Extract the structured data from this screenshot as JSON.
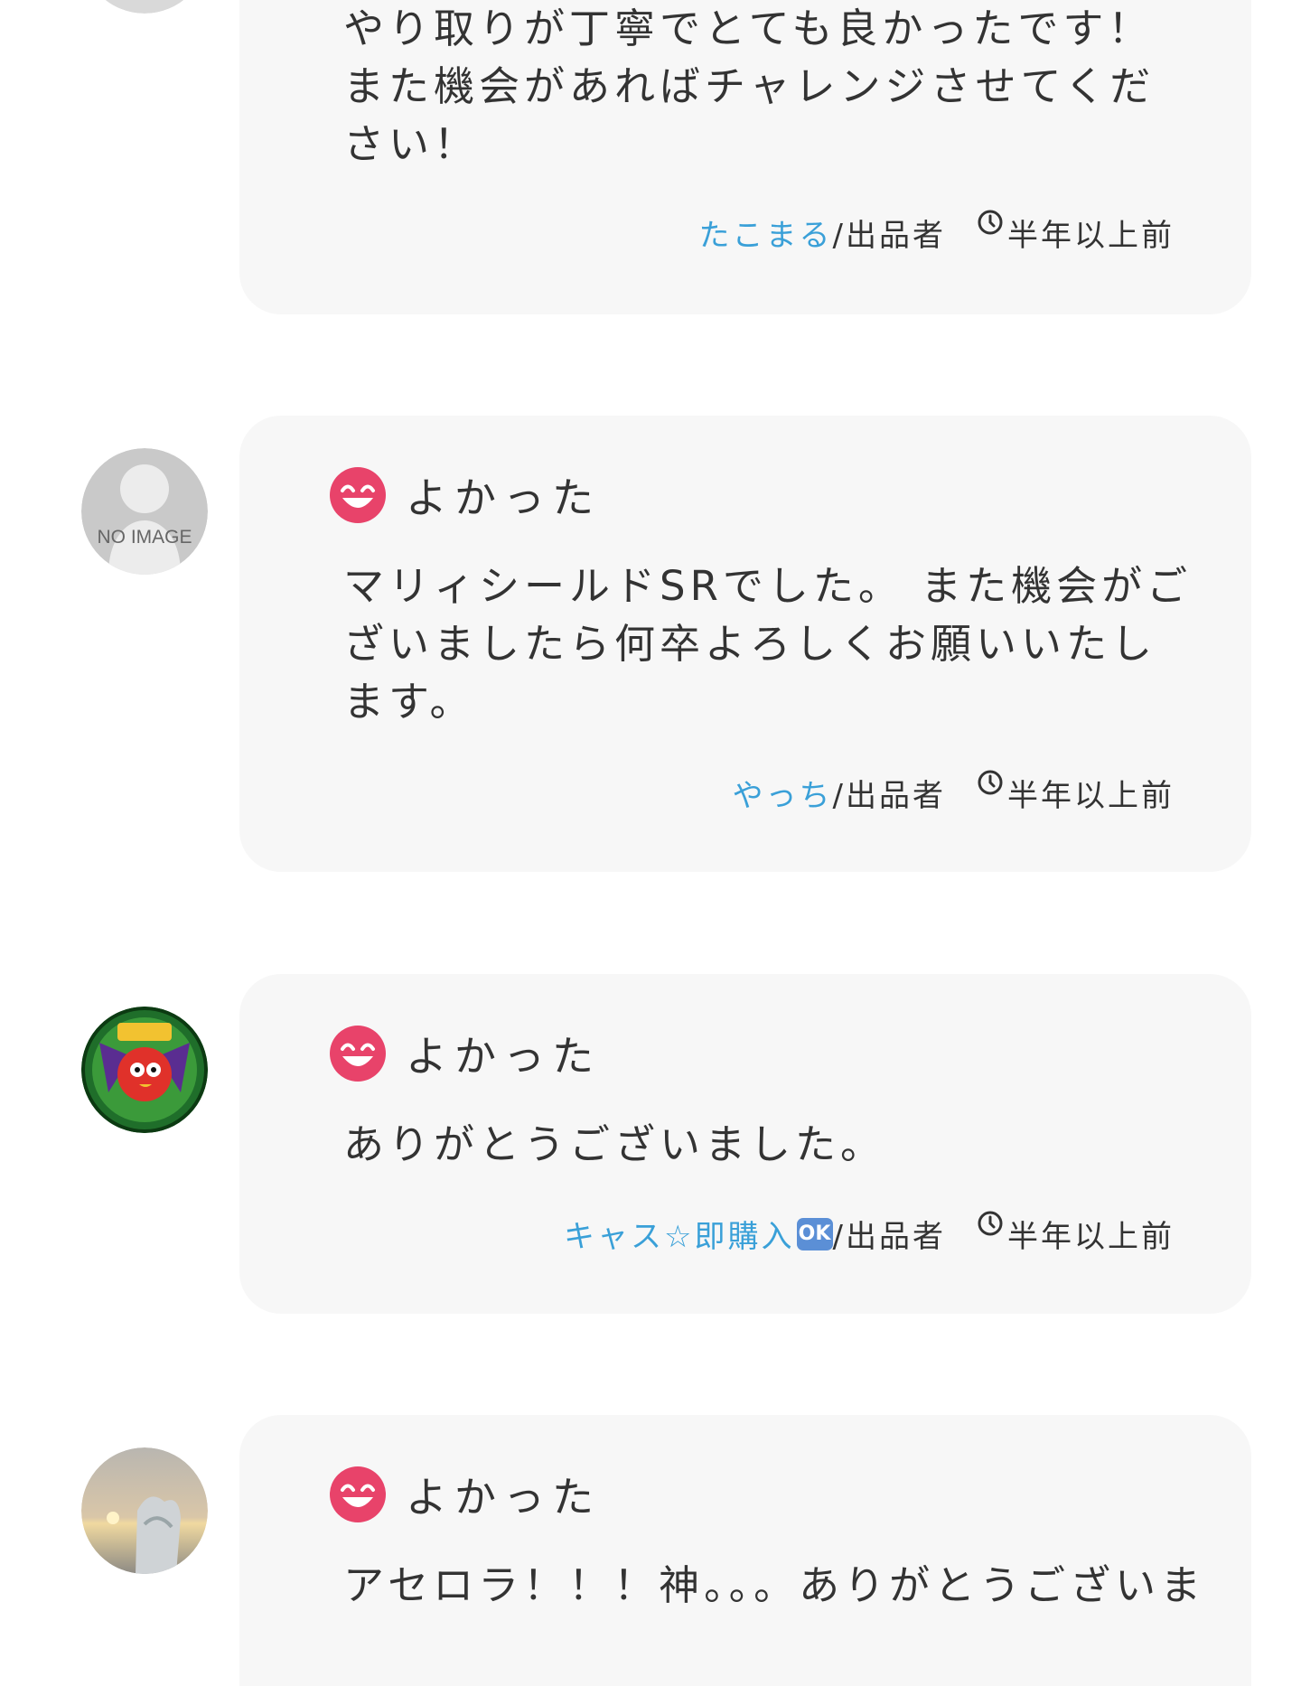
{
  "reviews": [
    {
      "avatar": "placeholder-avatar",
      "rating_icon": "smile-icon",
      "rating_label": "",
      "comment_lines": [
        "やり取りが丁寧でとても良かったです！",
        "また機会があればチャレンジさせてくだ",
        "さい！"
      ],
      "seller_name": "たこまる",
      "seller_badge": "",
      "role": "/出品者",
      "time": "半年以上前"
    },
    {
      "avatar": "no-image-avatar",
      "avatar_text": "NO IMAGE",
      "rating_icon": "smile-icon",
      "rating_label": "よかった",
      "comment_lines": [
        "マリィシールドSRでした。 また機会がご",
        "ざいましたら何卒よろしくお願いいたし",
        "ます。"
      ],
      "seller_name": "やっち",
      "seller_badge": "",
      "role": "/出品者",
      "time": "半年以上前"
    },
    {
      "avatar": "game-emblem-avatar",
      "rating_icon": "smile-icon",
      "rating_label": "よかった",
      "comment_lines": [
        "ありがとうございました。"
      ],
      "seller_name": "キャス☆即購入",
      "seller_badge": "OK",
      "role": "/出品者",
      "time": "半年以上前"
    },
    {
      "avatar": "sunset-photo-avatar",
      "rating_icon": "smile-icon",
      "rating_label": "よかった",
      "comment_lines": [
        "アセロラ！！！神。。。ありがとうございま"
      ],
      "seller_name": "",
      "seller_badge": "",
      "role": "",
      "time": ""
    }
  ],
  "icons": {
    "clock": "clock-icon",
    "rating": "smile-icon"
  },
  "colors": {
    "seller_link": "#3aa0d8",
    "rating_icon": "#e8436a",
    "card_background": "#f7f7f7",
    "ok_badge": "#5b8fd6"
  }
}
